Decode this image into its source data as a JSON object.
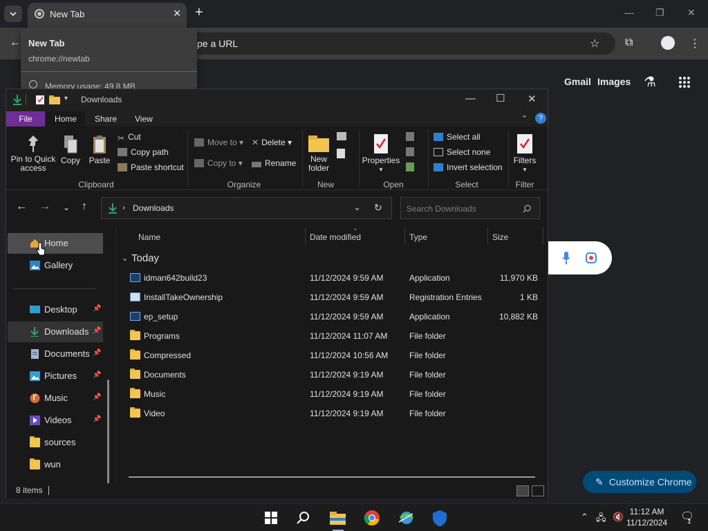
{
  "browser": {
    "tab_title": "New Tab",
    "omnibox_placeholder": "Search Google or type a URL",
    "omnibox_visible_text": "pe a URL",
    "hover_card": {
      "title": "New Tab",
      "url": "chrome://newtab",
      "memory": "Memory usage: 49.8 MB"
    },
    "links": {
      "gmail": "Gmail",
      "images": "Images"
    },
    "customize_label": "Customize Chrome"
  },
  "explorer": {
    "window_title": "Downloads",
    "ribbon_tabs": [
      "File",
      "Home",
      "Share",
      "View"
    ],
    "clipboard": {
      "pin_label": "Pin to Quick access",
      "pin_line1": "Pin to Quick",
      "pin_line2": "access",
      "copy": "Copy",
      "paste": "Paste",
      "cut": "Cut",
      "copy_path": "Copy path",
      "paste_shortcut": "Paste shortcut",
      "group": "Clipboard"
    },
    "organize": {
      "move_to": "Move to",
      "copy_to": "Copy to",
      "delete": "Delete",
      "rename": "Rename",
      "group": "Organize"
    },
    "new": {
      "new_folder_line1": "New",
      "new_folder_line2": "folder",
      "group": "New"
    },
    "open": {
      "properties": "Properties",
      "group": "Open"
    },
    "select": {
      "select_all": "Select all",
      "select_none": "Select none",
      "invert": "Invert selection",
      "group": "Select"
    },
    "filter": {
      "filters": "Filters",
      "group": "Filter"
    },
    "address": {
      "path": "Downloads",
      "search_placeholder": "Search Downloads"
    },
    "nav": [
      {
        "label": "Home",
        "pinned": false
      },
      {
        "label": "Gallery",
        "pinned": false
      },
      {
        "label": "Desktop",
        "pinned": true
      },
      {
        "label": "Downloads",
        "pinned": true
      },
      {
        "label": "Documents",
        "pinned": true
      },
      {
        "label": "Pictures",
        "pinned": true
      },
      {
        "label": "Music",
        "pinned": true
      },
      {
        "label": "Videos",
        "pinned": true
      },
      {
        "label": "sources",
        "pinned": false
      },
      {
        "label": "wun",
        "pinned": false
      }
    ],
    "columns": [
      "Name",
      "Date modified",
      "Type",
      "Size"
    ],
    "group_header": "Today",
    "files": [
      {
        "name": "idman642build23",
        "date": "11/12/2024 9:59 AM",
        "type": "Application",
        "size": "11,970 KB",
        "icon": "app"
      },
      {
        "name": "InstallTakeOwnership",
        "date": "11/12/2024 9:59 AM",
        "type": "Registration Entries",
        "size": "1 KB",
        "icon": "reg"
      },
      {
        "name": "ep_setup",
        "date": "11/12/2024 9:59 AM",
        "type": "Application",
        "size": "10,882 KB",
        "icon": "app"
      },
      {
        "name": "Programs",
        "date": "11/12/2024 11:07 AM",
        "type": "File folder",
        "size": "",
        "icon": "folder"
      },
      {
        "name": "Compressed",
        "date": "11/12/2024 10:56 AM",
        "type": "File folder",
        "size": "",
        "icon": "folder"
      },
      {
        "name": "Documents",
        "date": "11/12/2024 9:19 AM",
        "type": "File folder",
        "size": "",
        "icon": "folder"
      },
      {
        "name": "Music",
        "date": "11/12/2024 9:19 AM",
        "type": "File folder",
        "size": "",
        "icon": "folder"
      },
      {
        "name": "Video",
        "date": "11/12/2024 9:19 AM",
        "type": "File folder",
        "size": "",
        "icon": "folder"
      }
    ],
    "status": "8 items"
  },
  "taskbar": {
    "time": "11:12 AM",
    "date": "11/12/2024",
    "notification_count": "1"
  },
  "colors": {
    "file_tab": "#6e2d99",
    "accent_blue": "#2f7fd1",
    "folder_yellow": "#f2c552",
    "customize_bg": "#004a77"
  }
}
